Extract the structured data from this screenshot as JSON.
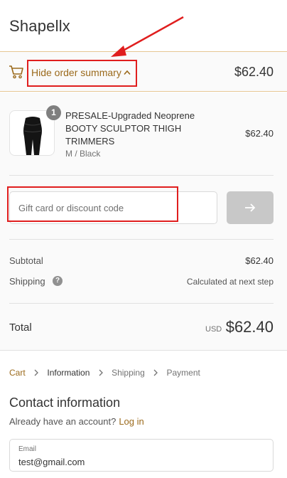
{
  "header": {
    "brand": "Shapellx"
  },
  "summary_toggle": {
    "label": "Hide order summary",
    "total": "$62.40"
  },
  "product": {
    "quantity": "1",
    "name": "PRESALE-Upgraded Neoprene BOOTY SCULPTOR THIGH TRIMMERS",
    "variant": "M / Black",
    "price": "$62.40"
  },
  "discount": {
    "placeholder": "Gift card or discount code"
  },
  "totals": {
    "subtotal_label": "Subtotal",
    "subtotal_value": "$62.40",
    "shipping_label": "Shipping",
    "shipping_help": "?",
    "shipping_value": "Calculated at next step",
    "total_label": "Total",
    "currency": "USD",
    "total_value": "$62.40"
  },
  "breadcrumbs": [
    "Cart",
    "Information",
    "Shipping",
    "Payment"
  ],
  "contact": {
    "title": "Contact information",
    "account_prompt": "Already have an account?",
    "login_label": "Log in",
    "email_label": "Email",
    "email_value": "test@gmail.com"
  },
  "colors": {
    "accent": "#9b6a1c",
    "toggle_border": "#e6c794",
    "annotation": "#e01e1e",
    "apply_button": "#c8c8c8"
  },
  "icons": [
    "cart-icon",
    "chevron-up-icon",
    "arrow-right-icon",
    "help-icon",
    "chevron-right-icon"
  ]
}
